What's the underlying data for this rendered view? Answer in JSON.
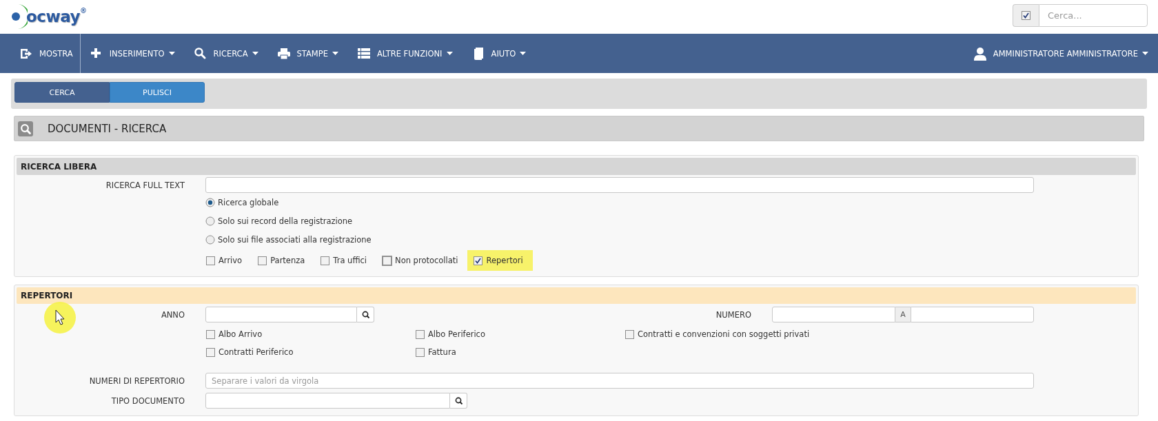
{
  "logo": {
    "text": "ocway",
    "mark": "®"
  },
  "header_search": {
    "checked": true,
    "placeholder": "Cerca..."
  },
  "nav": {
    "items": [
      {
        "label": "MOSTRA",
        "dropdown": false
      },
      {
        "label": "INSERIMENTO",
        "dropdown": true
      },
      {
        "label": "RICERCA",
        "dropdown": true
      },
      {
        "label": "STAMPE",
        "dropdown": true
      },
      {
        "label": "ALTRE FUNZIONI",
        "dropdown": true
      },
      {
        "label": "AIUTO",
        "dropdown": true
      }
    ],
    "user": {
      "label": "AMMINISTRATORE AMMINISTRATORE",
      "dropdown": true
    }
  },
  "toolbar": {
    "buttons": [
      {
        "label": "CERCA",
        "kind": "primary"
      },
      {
        "label": "PULISCI",
        "kind": "secondary"
      }
    ]
  },
  "page_title": "DOCUMENTI - RICERCA",
  "ricerca_libera": {
    "title": "RICERCA LIBERA",
    "full_text": {
      "label": "RICERCA FULL TEXT"
    },
    "scope_options": [
      {
        "label": "Ricerca globale",
        "selected": true
      },
      {
        "label": "Solo sui record della registrazione",
        "selected": false
      },
      {
        "label": "Solo sui file associati alla registrazione",
        "selected": false
      }
    ],
    "filters": [
      {
        "label": "Arrivo",
        "checked": false,
        "focused": false,
        "highlighted": false
      },
      {
        "label": "Partenza",
        "checked": false,
        "focused": false,
        "highlighted": false
      },
      {
        "label": "Tra uffici",
        "checked": false,
        "focused": false,
        "highlighted": false
      },
      {
        "label": "Non protocollati",
        "checked": false,
        "focused": true,
        "highlighted": false
      },
      {
        "label": "Repertori",
        "checked": true,
        "focused": false,
        "highlighted": true
      }
    ]
  },
  "repertori": {
    "title": "REPERTORI",
    "anno": {
      "label": "ANNO"
    },
    "numero": {
      "label": "NUMERO",
      "separator": "A"
    },
    "types": [
      {
        "label": "Albo Arrivo",
        "checked": false
      },
      {
        "label": "Albo Periferico",
        "checked": false
      },
      {
        "label": "Contratti e convenzioni con soggetti privati",
        "checked": false
      },
      {
        "label": "Contratti Periferico",
        "checked": false
      },
      {
        "label": "Fattura",
        "checked": false
      }
    ],
    "numeri": {
      "label": "NUMERI DI REPERTORIO",
      "placeholder": "Separare i valori da virgola"
    },
    "tipo": {
      "label": "TIPO DOCUMENTO"
    }
  }
}
